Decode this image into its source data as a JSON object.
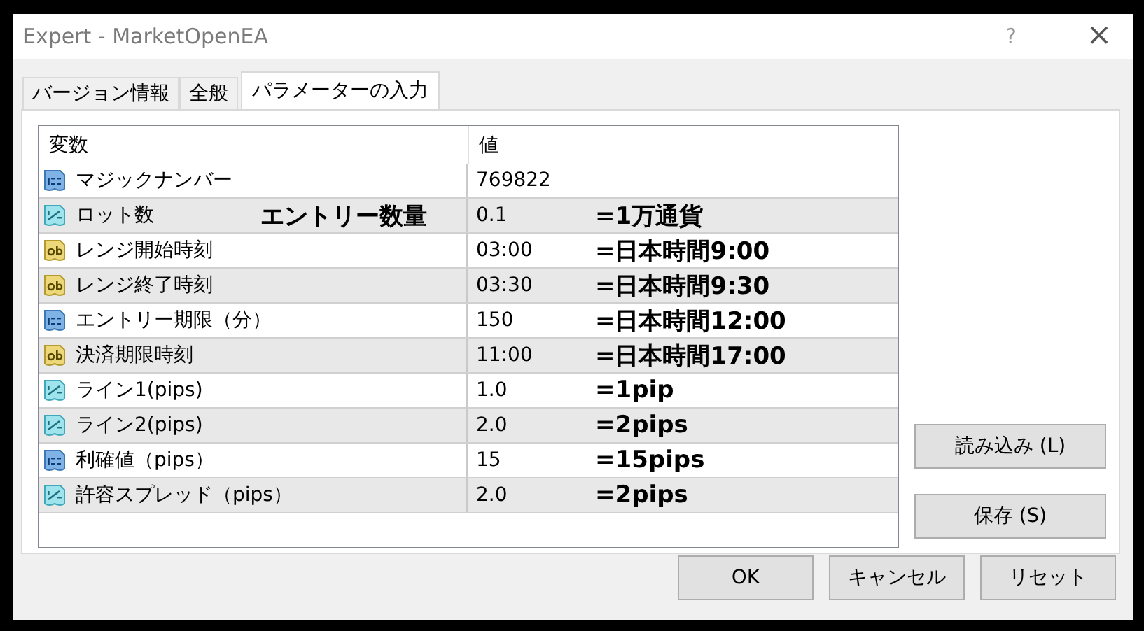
{
  "window": {
    "title": "Expert - MarketOpenEA",
    "help": "?",
    "close": "×"
  },
  "tabs": [
    {
      "label": "バージョン情報",
      "selected": false
    },
    {
      "label": "全般",
      "selected": false
    },
    {
      "label": "パラメーターの入力",
      "selected": true
    }
  ],
  "table": {
    "columns": [
      "変数",
      "値"
    ],
    "rows": [
      {
        "kind": "int",
        "name": "マジックナンバー",
        "value": "769822"
      },
      {
        "kind": "double",
        "name": "ロット数",
        "value": "0.1",
        "name_note": "エントリー数量",
        "note": "=1万通貨"
      },
      {
        "kind": "string",
        "name": "レンジ開始時刻",
        "value": "03:00",
        "note": "=日本時間9:00"
      },
      {
        "kind": "string",
        "name": "レンジ終了時刻",
        "value": "03:30",
        "note": "=日本時間9:30"
      },
      {
        "kind": "int",
        "name": "エントリー期限（分）",
        "value": "150",
        "note": "=日本時間12:00"
      },
      {
        "kind": "string",
        "name": "決済期限時刻",
        "value": "11:00",
        "note": "=日本時間17:00"
      },
      {
        "kind": "double",
        "name": "ライン1(pips)",
        "value": "1.0",
        "note": "=1pip"
      },
      {
        "kind": "double",
        "name": "ライン2(pips)",
        "value": "2.0",
        "note": "=2pips"
      },
      {
        "kind": "int",
        "name": "利確値（pips）",
        "value": "15",
        "note": "=15pips"
      },
      {
        "kind": "double",
        "name": "許容スプレッド（pips）",
        "value": "2.0",
        "note": "=2pips"
      }
    ]
  },
  "side_buttons": [
    "読み込み (L)",
    "保存 (S)"
  ],
  "buttons": [
    "OK",
    "キャンセル",
    "リセット"
  ]
}
